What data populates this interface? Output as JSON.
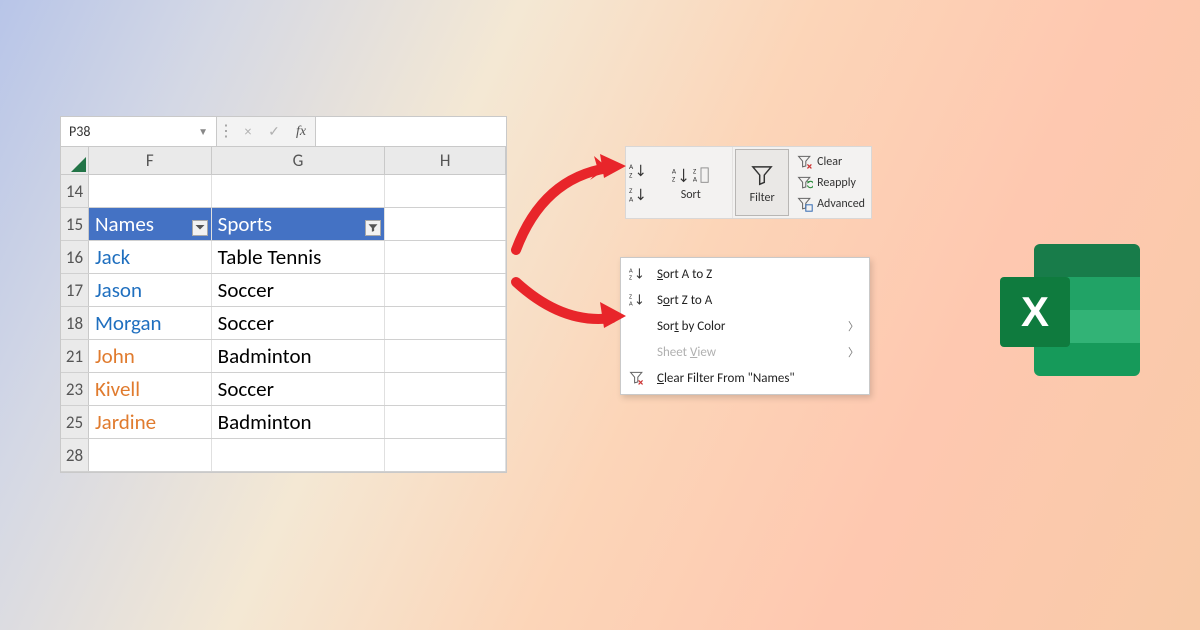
{
  "formula_bar": {
    "namebox_value": "P38",
    "cancel": "×",
    "confirm": "✓",
    "fx_label": "fx"
  },
  "columns": {
    "F": "F",
    "G": "G",
    "H": "H"
  },
  "header_row": {
    "num": "15",
    "names_label": "Names",
    "sports_label": "Sports"
  },
  "rows": [
    {
      "num": "14",
      "name": "",
      "sport": "",
      "color": ""
    },
    {
      "num": "16",
      "name": "Jack",
      "sport": "Table Tennis",
      "color": "blue"
    },
    {
      "num": "17",
      "name": "Jason",
      "sport": "Soccer",
      "color": "blue"
    },
    {
      "num": "18",
      "name": "Morgan",
      "sport": "Soccer",
      "color": "blue"
    },
    {
      "num": "21",
      "name": "John",
      "sport": "Badminton",
      "color": "orange"
    },
    {
      "num": "23",
      "name": "Kivell",
      "sport": "Soccer",
      "color": "orange"
    },
    {
      "num": "25",
      "name": "Jardine",
      "sport": "Badminton",
      "color": "orange"
    },
    {
      "num": "28",
      "name": "",
      "sport": "",
      "color": ""
    }
  ],
  "ribbon": {
    "sort_label": "Sort",
    "filter_label": "Filter",
    "clear_label": "Clear",
    "reapply_label": "Reapply",
    "advanced_label": "Advanced"
  },
  "context_menu": {
    "sort_az": "Sort A to Z",
    "sort_za": "Sort Z to A",
    "sort_by_color": "Sort by Color",
    "sheet_view": "Sheet View",
    "clear_filter": "Clear Filter From \"Names\""
  },
  "logo_letter": "X",
  "chart_data": {
    "type": "table",
    "columns": [
      "Names",
      "Sports"
    ],
    "rows": [
      [
        "Jack",
        "Table Tennis"
      ],
      [
        "Jason",
        "Soccer"
      ],
      [
        "Morgan",
        "Soccer"
      ],
      [
        "John",
        "Badminton"
      ],
      [
        "Kivell",
        "Soccer"
      ],
      [
        "Jardine",
        "Badminton"
      ]
    ]
  }
}
